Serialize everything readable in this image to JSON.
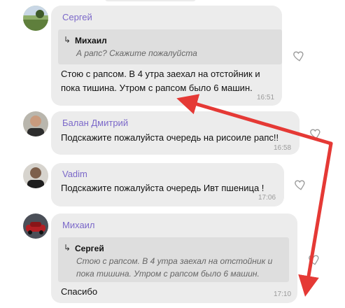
{
  "messages": [
    {
      "author": "Сергей",
      "avatar": "avatar-photo-landscape",
      "reply": {
        "arrow": "↳",
        "author": "Михаил",
        "text": "А рапс?  Скажите пожалуйста"
      },
      "lines": [
        "Стою с рапсом. В 4 утра заехал на отстойник и",
        "пока тишина. Утром с рапсом было 6 машин."
      ],
      "time": "16:51"
    },
    {
      "author": "Балан Дмитрий",
      "avatar": "avatar-photo-man",
      "lines": [
        "Подскажите пожалуйста очередь на рисоиле рапс!!"
      ],
      "time": "16:58"
    },
    {
      "author": "Vadim",
      "avatar": "avatar-photo-man-dark",
      "lines": [
        "Подскажите пожалуйста очередь Ивт пшеница !"
      ],
      "time": "17:06"
    },
    {
      "author": "Михаил",
      "avatar": "avatar-photo-car",
      "reply": {
        "arrow": "↳",
        "author": "Сергей",
        "lines": [
          "Стою с рапсом. В 4 утра заехал на отстойник и",
          "пока тишина. Утром с рапсом было 6 машин."
        ]
      },
      "lines": [
        "Спасибо"
      ],
      "time": "17:10"
    }
  ],
  "icons": {
    "like": "heart-outline-icon"
  },
  "colors": {
    "author_name": "#7b68c9",
    "bubble": "#ececec",
    "quote": "#dedede",
    "annotation_arrow": "#e53935"
  }
}
